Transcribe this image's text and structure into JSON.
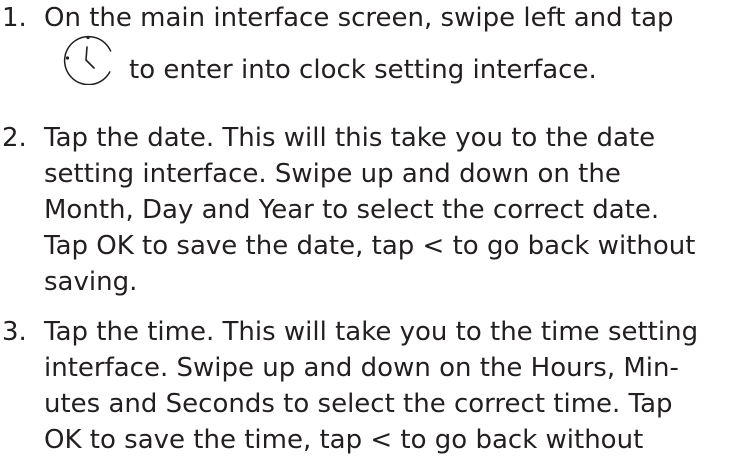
{
  "instructions": {
    "steps": [
      {
        "number": "1.",
        "lines": [
          "On the main interface screen, swipe left and tap"
        ],
        "icon": "clock-icon",
        "after_icon": "to enter into clock setting interface."
      },
      {
        "number": "2.",
        "lines": [
          "Tap the date. This will this take you to the date",
          "setting interface. Swipe up and down on the",
          "Month, Day and Year to select the correct date.",
          "Tap OK to save the date, tap < to go back without",
          "saving."
        ]
      },
      {
        "number": "3.",
        "lines": [
          "Tap the time. This will take you to the time setting",
          "interface. Swipe up and down on the Hours, Min-",
          "utes and Seconds to select the correct time. Tap",
          "OK to save the time, tap < to go back without"
        ]
      }
    ]
  }
}
